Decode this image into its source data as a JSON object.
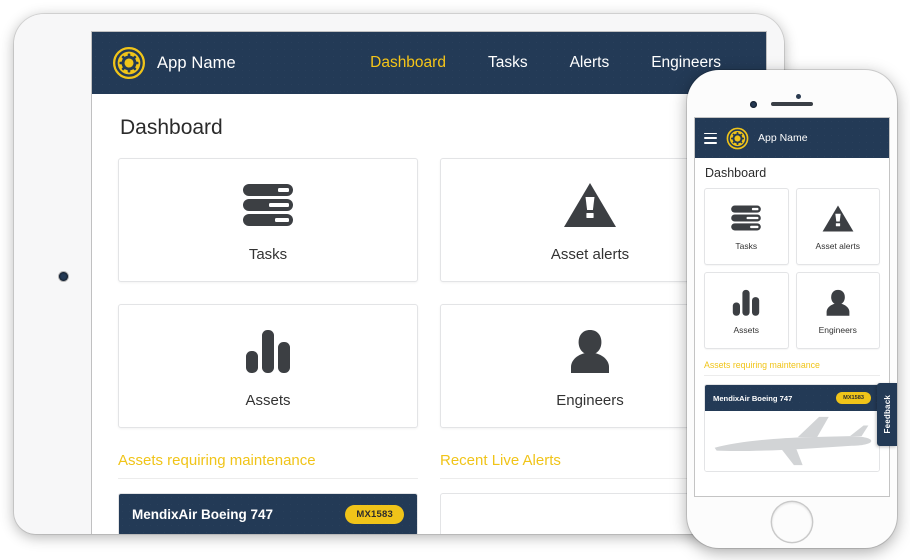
{
  "brand": {
    "name": "App Name",
    "logo_icon": "gear-cog-icon",
    "accent_yellow": "#F0C419",
    "navy": "#233A56"
  },
  "tablet": {
    "device": "ipad-landscape",
    "nav": {
      "items": [
        {
          "label": "Dashboard",
          "active": true
        },
        {
          "label": "Tasks",
          "active": false
        },
        {
          "label": "Alerts",
          "active": false
        },
        {
          "label": "Engineers",
          "active": false
        }
      ]
    },
    "page_title": "Dashboard",
    "cards": [
      {
        "label": "Tasks",
        "icon": "server-stack-icon"
      },
      {
        "label": "Asset alerts",
        "icon": "warning-triangle-icon"
      },
      {
        "label": "Assets",
        "icon": "bar-chart-icon"
      },
      {
        "label": "Engineers",
        "icon": "person-icon"
      }
    ],
    "sections": [
      {
        "title": "Assets requiring maintenance"
      },
      {
        "title": "Recent Live Alerts"
      }
    ],
    "asset_item": {
      "name": "MendixAir Boeing 747",
      "badge": "MX1583",
      "image": "airplane-silhouette"
    }
  },
  "phone": {
    "device": "iphone-portrait",
    "menu_icon": "hamburger-menu-icon",
    "brand_name": "App Name",
    "page_title": "Dashboard",
    "cards": [
      {
        "label": "Tasks",
        "icon": "server-stack-icon"
      },
      {
        "label": "Asset alerts",
        "icon": "warning-triangle-icon"
      },
      {
        "label": "Assets",
        "icon": "bar-chart-icon"
      },
      {
        "label": "Engineers",
        "icon": "person-icon"
      }
    ],
    "section_title": "Assets requiring maintenance",
    "asset_item": {
      "name": "MendixAir Boeing 747",
      "badge": "MX1583",
      "image": "airplane-silhouette"
    },
    "feedback_tab": "Feedback"
  }
}
